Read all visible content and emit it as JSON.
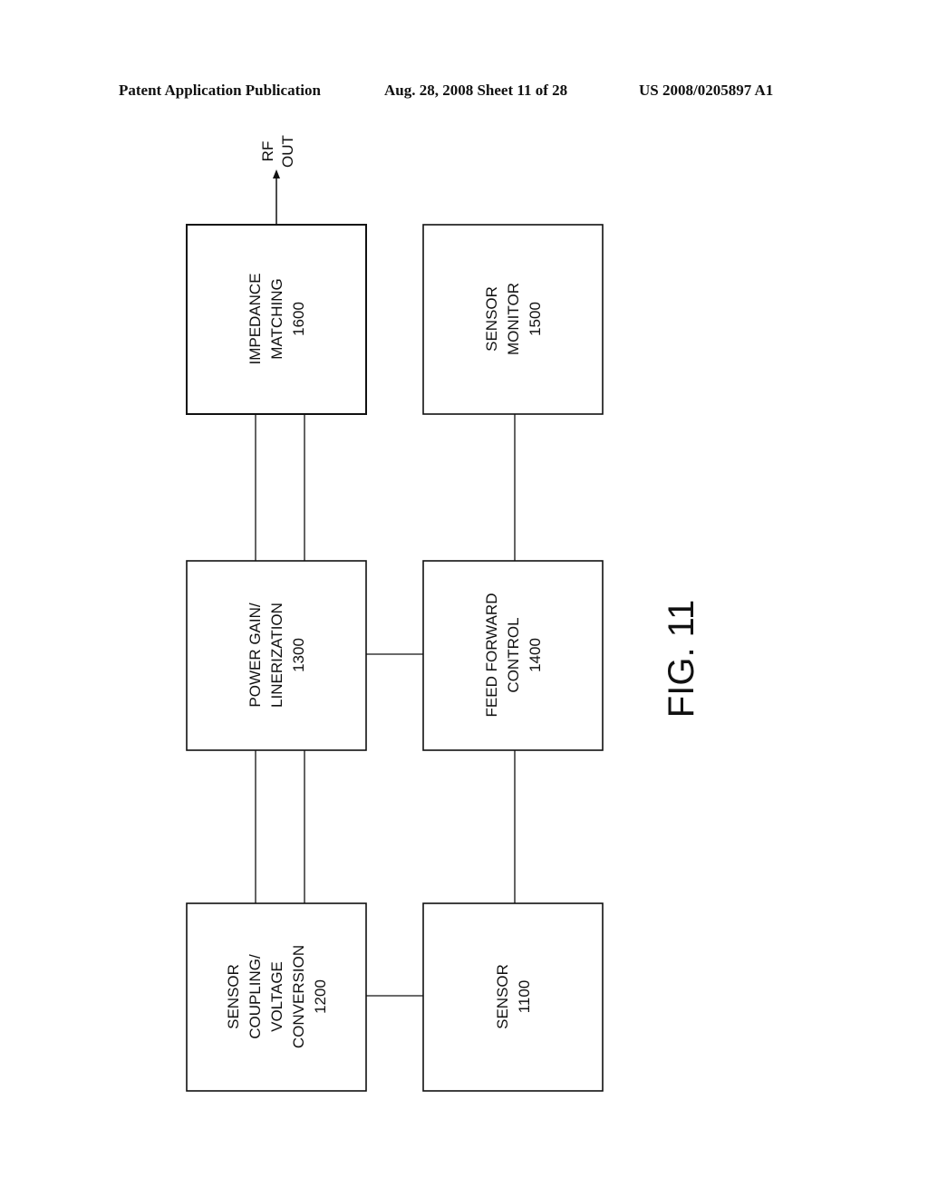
{
  "header": {
    "publication": "Patent Application Publication",
    "date_sheet": "Aug. 28, 2008  Sheet 11 of 28",
    "number": "US 2008/0205897 A1"
  },
  "figure_label": "FIG. 11",
  "output_label": [
    "RF",
    "OUT"
  ],
  "blocks": [
    {
      "id": "1600",
      "lines": [
        "IMPEDANCE",
        "MATCHING",
        "1600"
      ]
    },
    {
      "id": "1500",
      "lines": [
        "SENSOR",
        "MONITOR",
        "1500"
      ]
    },
    {
      "id": "1300",
      "lines": [
        "POWER GAIN/",
        "LINERIZATION",
        "1300"
      ]
    },
    {
      "id": "1400",
      "lines": [
        "FEED FORWARD",
        "CONTROL",
        "1400"
      ]
    },
    {
      "id": "1200",
      "lines": [
        "SENSOR",
        "COUPLING/",
        "VOLTAGE",
        "CONVERSION",
        "1200"
      ]
    },
    {
      "id": "1100",
      "lines": [
        "SENSOR",
        "1100"
      ]
    }
  ]
}
